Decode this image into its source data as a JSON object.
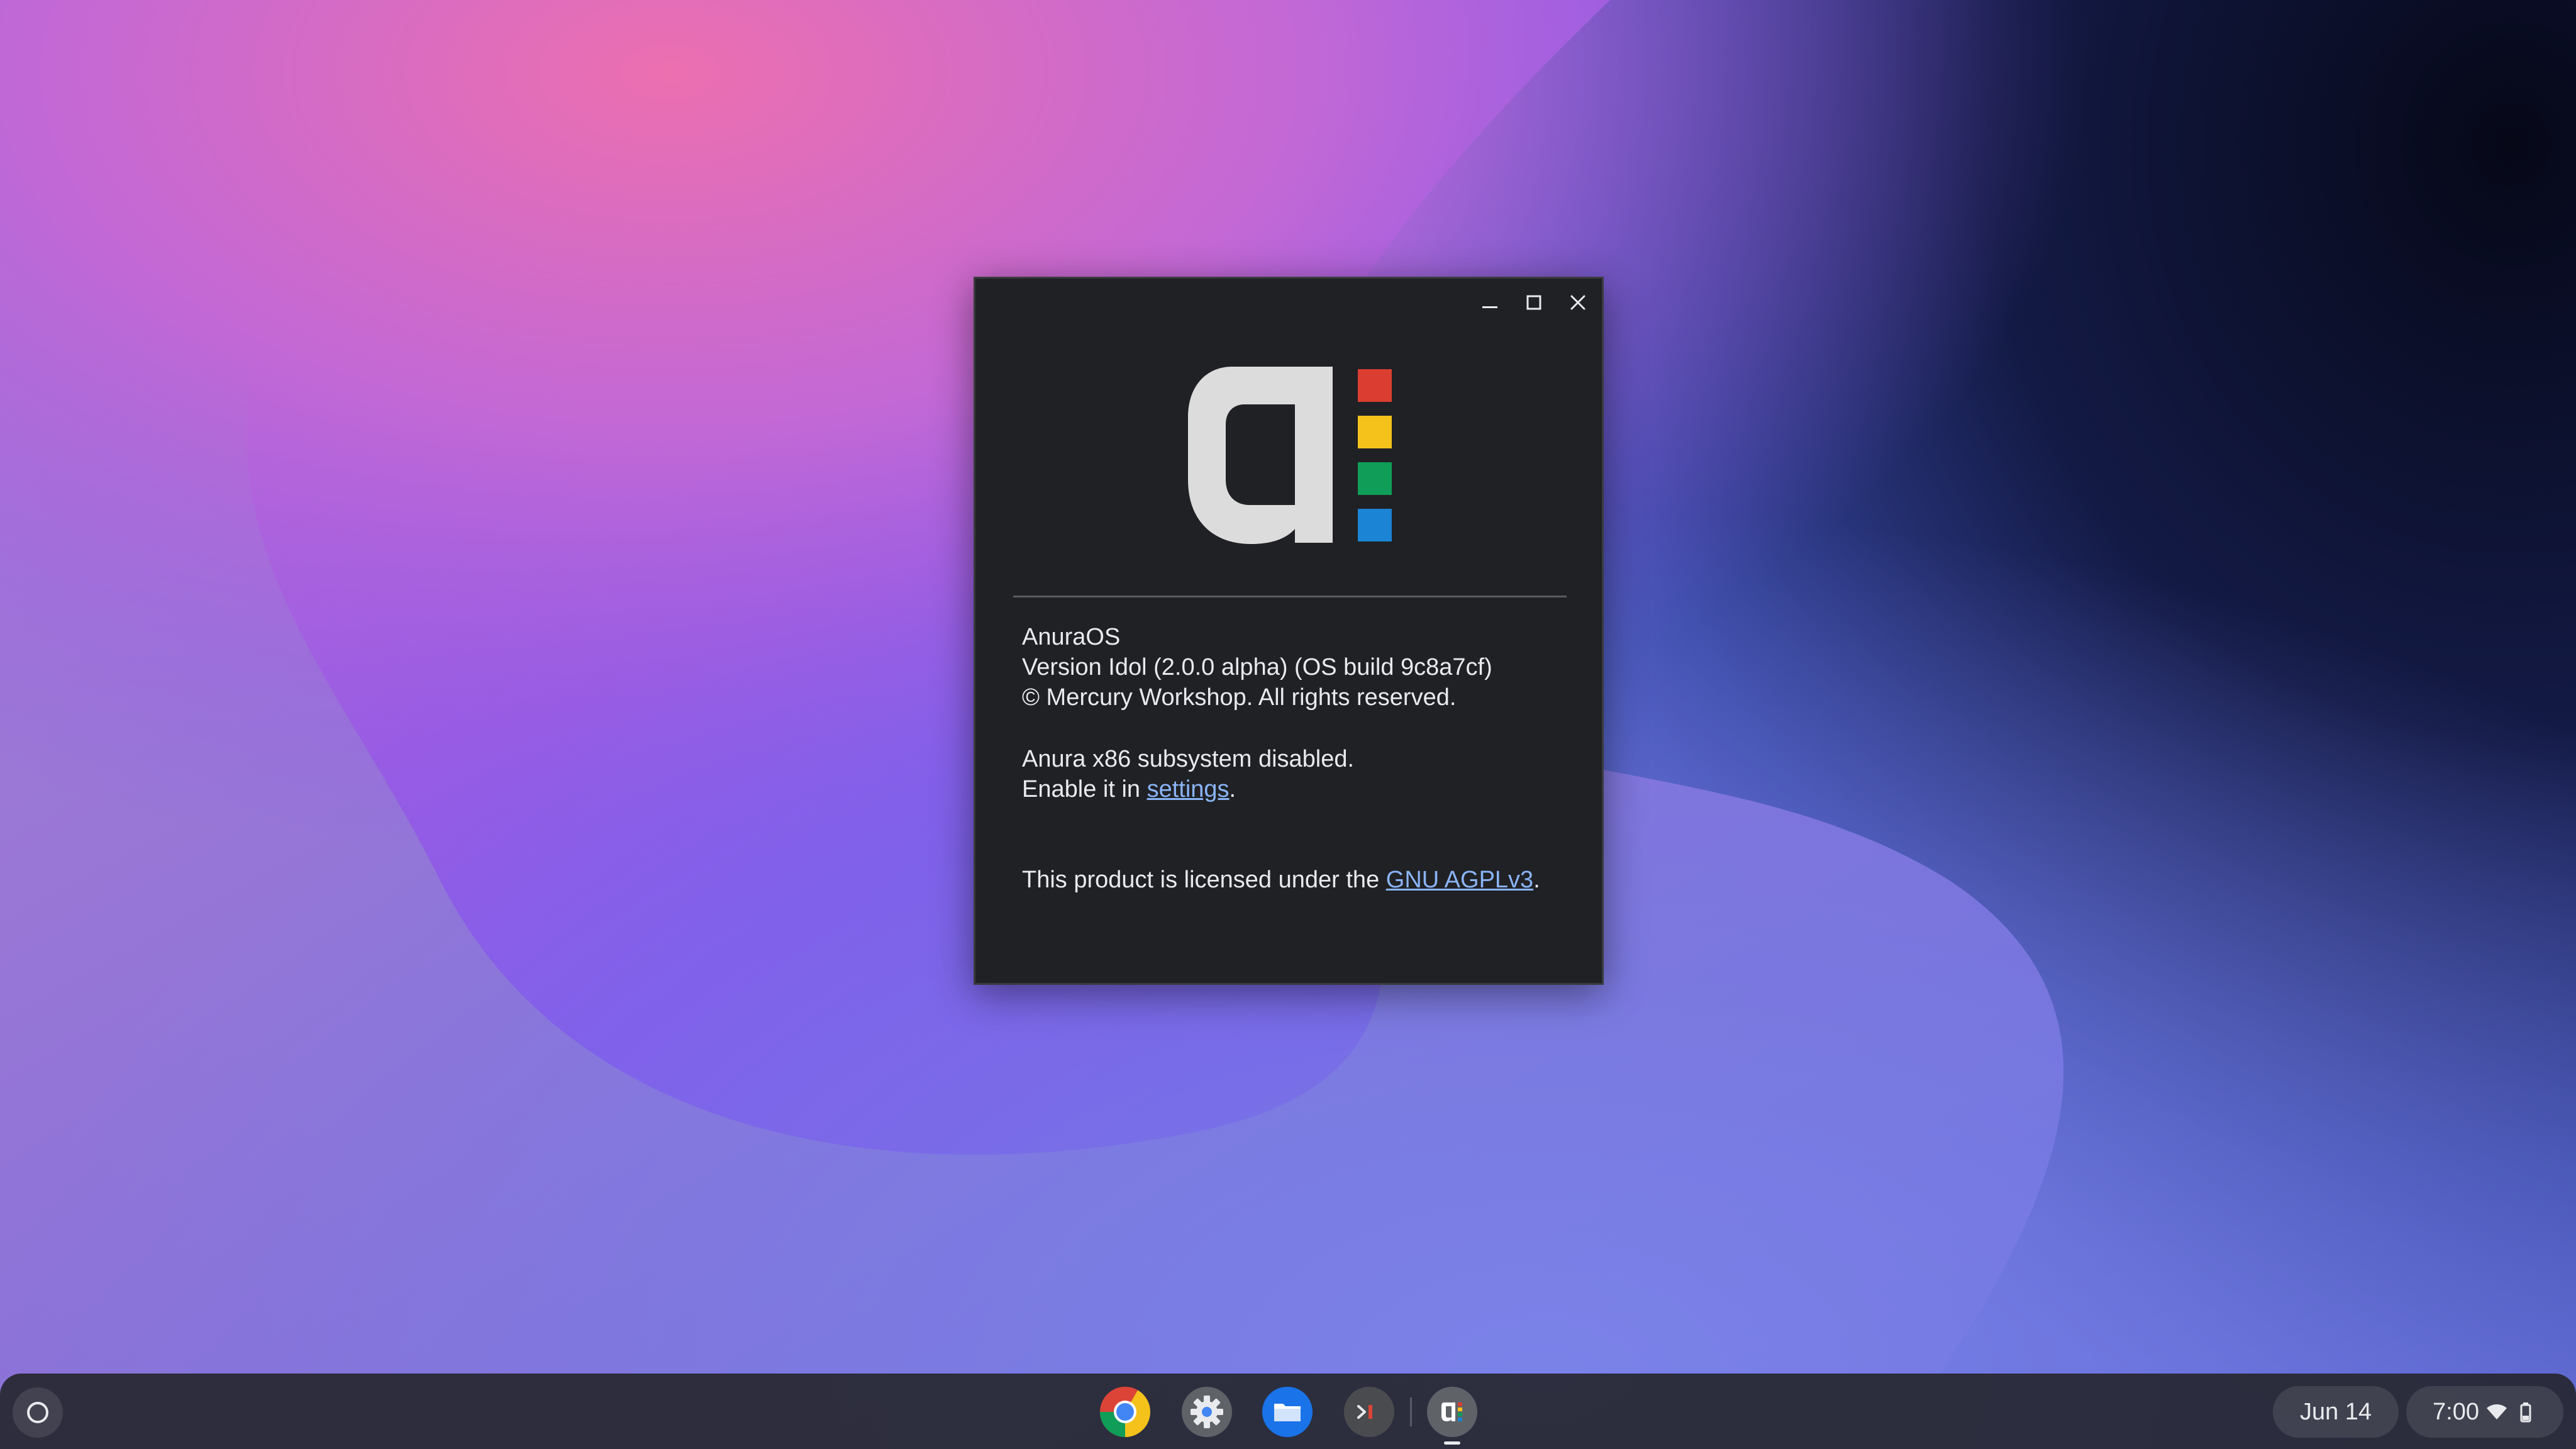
{
  "desktop": {
    "wallpaper": {
      "colors": {
        "pink": "#e46fb0",
        "violet": "#7a4fe8",
        "lavender": "#9b7fd6",
        "navy": "#0c0f2a"
      }
    }
  },
  "about_window": {
    "controls": {
      "minimize_icon": "minimize-icon",
      "maximize_icon": "maximize-icon",
      "close_icon": "close-icon"
    },
    "logo": {
      "letter": "a",
      "letter_color": "#dcdcdc",
      "square_colors": [
        "#db3e31",
        "#f4c21b",
        "#0f9d58",
        "#1c84d4"
      ]
    },
    "os_name": "AnuraOS",
    "version": "Version Idol (2.0.0 alpha) (OS build 9c8a7cf)",
    "copyright": "© Mercury Workshop. All rights reserved.",
    "x86_status": "Anura x86 subsystem disabled.",
    "x86_hint_prefix": "Enable it in ",
    "x86_hint_link": "settings",
    "x86_hint_suffix": ".",
    "license_prefix": "This product is licensed under the ",
    "license_link": "GNU AGPLv3",
    "license_suffix": ".",
    "colors": {
      "background": "#202124",
      "text": "#e8eaed",
      "link": "#8ab4f8"
    }
  },
  "shelf": {
    "launcher_icon": "launcher-circle-icon",
    "apps": [
      {
        "name": "Chrome",
        "icon": "chrome-icon"
      },
      {
        "name": "Settings",
        "icon": "gear-icon"
      },
      {
        "name": "Files",
        "icon": "folder-icon"
      },
      {
        "name": "Terminal",
        "icon": "terminal-icon"
      },
      {
        "name": "About Anura",
        "icon": "anura-logo-icon",
        "running": true
      }
    ],
    "date": "Jun 14",
    "time": "7:00",
    "status_icons": [
      "wifi-icon",
      "battery-icon"
    ]
  }
}
